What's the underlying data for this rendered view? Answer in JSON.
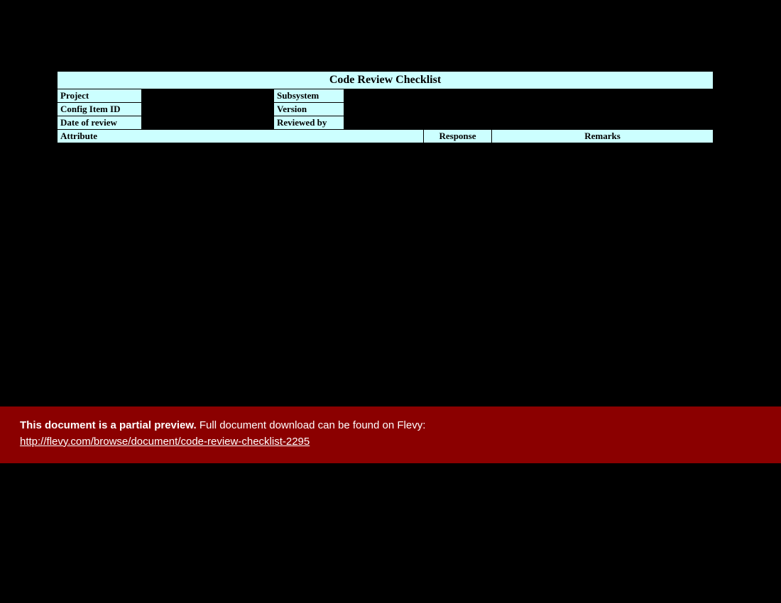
{
  "title": "Code Review Checklist",
  "meta": {
    "project_label": "Project",
    "project_value": "",
    "subsystem_label": "Subsystem",
    "subsystem_value": "",
    "config_label": "Config Item ID",
    "config_value": "",
    "version_label": "Version",
    "version_value": "",
    "date_label": "Date of review",
    "date_value": "",
    "reviewed_label": "Reviewed by",
    "reviewed_value": ""
  },
  "columns": {
    "attribute": "Attribute",
    "response": "Response",
    "remarks": "Remarks"
  },
  "banner": {
    "bold": "This document is a partial preview.",
    "rest": "  Full document download can be found on Flevy:",
    "link_text": "http://flevy.com/browse/document/code-review-checklist-2295",
    "link_href": "http://flevy.com/browse/document/code-review-checklist-2295"
  }
}
